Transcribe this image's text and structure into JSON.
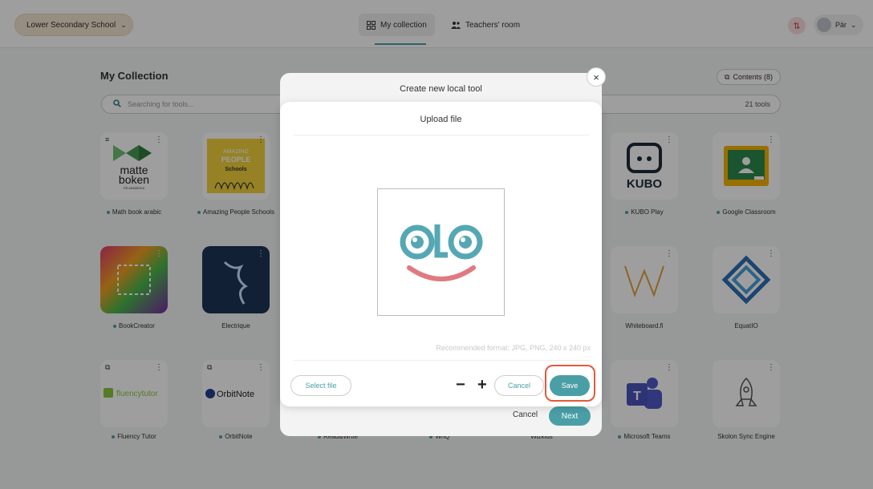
{
  "header": {
    "school": "Lower Secondary School",
    "tabs": [
      {
        "label": "My collection"
      },
      {
        "label": "Teachers' room"
      }
    ],
    "user_name": "Pär"
  },
  "collection": {
    "title": "My Collection",
    "contents_label": "Contents (8)",
    "search_placeholder": "Searching for tools...",
    "tools_count": "21 tools"
  },
  "tiles": [
    {
      "label": "Math book arabic"
    },
    {
      "label": "Amazing People Schools"
    },
    {
      "label": "KUBO Play"
    },
    {
      "label": "Google Classroom"
    },
    {
      "label": "BookCreator"
    },
    {
      "label": "Electrique"
    },
    {
      "label": "Whiteboard.fi"
    },
    {
      "label": "EquatIO"
    },
    {
      "label": "Fluency Tutor"
    },
    {
      "label": "OrbitNote"
    },
    {
      "label": "Read&Write"
    },
    {
      "label": "WriQ"
    },
    {
      "label": "Wizkids"
    },
    {
      "label": "Microsoft Teams"
    },
    {
      "label": "Skolon Sync Engine"
    }
  ],
  "logo_text": {
    "matte_line1": "matte",
    "matte_line2": "boken",
    "matte_sub": "PÅ ARABISKA",
    "amazing_line1": "AMAZING",
    "amazing_line2": "PEOPLE",
    "amazing_line3": "Schools",
    "kubo": "KUBO",
    "fluency": "fluencytutor",
    "orbit": "OrbitNote"
  },
  "modal_back": {
    "title": "Create new local tool",
    "cancel_label": "Cancel",
    "next_label": "Next"
  },
  "modal_front": {
    "title": "Upload file",
    "hint": "Recommended format: JPG, PNG, 240 x 240 px",
    "select_file_label": "Select file",
    "zoom_out": "−",
    "zoom_in": "+",
    "cancel_label": "Cancel",
    "save_label": "Save"
  },
  "colors": {
    "accent": "#4a9fa6",
    "highlight": "#e25a3c",
    "school_pill": "#f3e5cf"
  }
}
